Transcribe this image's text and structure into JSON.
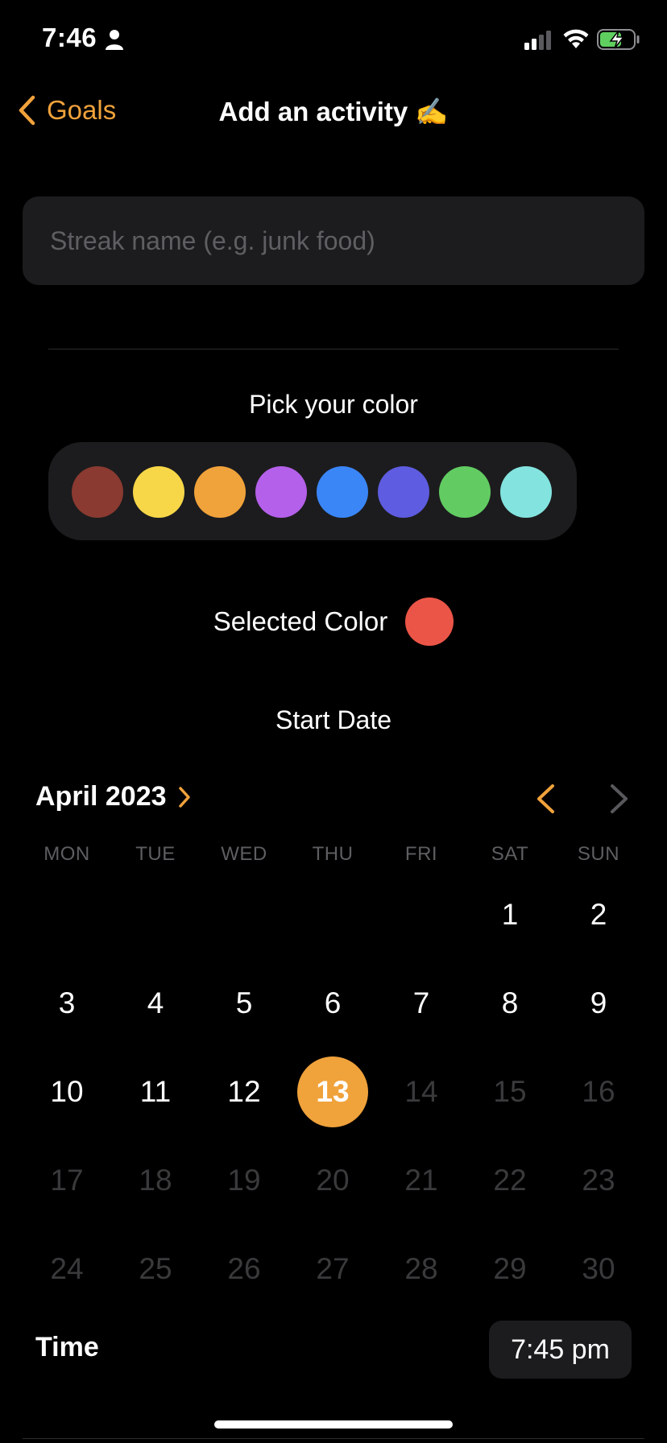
{
  "status_bar": {
    "time": "7:46"
  },
  "nav": {
    "back_label": "Goals",
    "title": "Add an activity ✍️"
  },
  "streak_input": {
    "placeholder": "Streak name (e.g. junk food)",
    "value": ""
  },
  "color_picker": {
    "title": "Pick your color",
    "colors": [
      "#8a3a30",
      "#f7d748",
      "#f0a23b",
      "#b460ea",
      "#3a86f7",
      "#5e5ce0",
      "#62cc62",
      "#83e3df"
    ]
  },
  "selected_color": {
    "label": "Selected Color",
    "color": "#eb5547"
  },
  "start_date": {
    "title": "Start Date"
  },
  "calendar": {
    "month_label": "April 2023",
    "weekdays": [
      "MON",
      "TUE",
      "WED",
      "THU",
      "FRI",
      "SAT",
      "SUN"
    ],
    "days": [
      "1",
      "2",
      "3",
      "4",
      "5",
      "6",
      "7",
      "8",
      "9",
      "10",
      "11",
      "12",
      "13",
      "14",
      "15",
      "16",
      "17",
      "18",
      "19",
      "20",
      "21",
      "22",
      "23",
      "24",
      "25",
      "26",
      "27",
      "28",
      "29",
      "30"
    ],
    "selected_day": "13",
    "accent": "#f0a23b"
  },
  "time_row": {
    "label": "Time",
    "value": "7:45 pm"
  }
}
